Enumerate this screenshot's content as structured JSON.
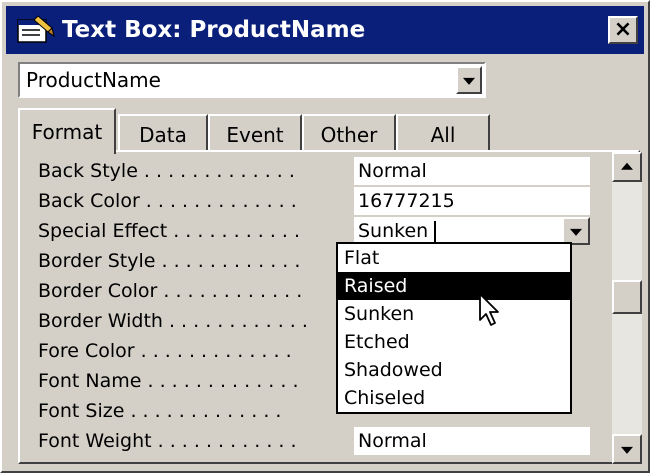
{
  "window": {
    "title": "Text Box: ProductName",
    "close_glyph": "×",
    "accent_title_bar": "#0a1f7a"
  },
  "object_selector": {
    "value": "ProductName"
  },
  "tabs": [
    {
      "label": "Format",
      "active": true
    },
    {
      "label": "Data",
      "active": false
    },
    {
      "label": "Event",
      "active": false
    },
    {
      "label": "Other",
      "active": false
    },
    {
      "label": "All",
      "active": false
    }
  ],
  "properties": [
    {
      "label": "Back Style . . . . . . . . . . . . .",
      "value": "Normal"
    },
    {
      "label": "Back Color . . . . . . . . . . . . .",
      "value": "16777215"
    },
    {
      "label": "Special Effect . . . . . . . . . . .",
      "value": "Sunken"
    },
    {
      "label": "Border Style . . . . . . . . . . . .",
      "value": ""
    },
    {
      "label": "Border Color . . . . . . . . . . . .",
      "value": ""
    },
    {
      "label": "Border Width . . . . . . . . . . . .",
      "value": ""
    },
    {
      "label": "Fore Color . . . . . . . . . . . . .",
      "value": ""
    },
    {
      "label": "Font Name . . . . . . . . . . . . .",
      "value": ""
    },
    {
      "label": "Font Size . . . . . . . . . . . . .",
      "value": ""
    },
    {
      "label": "Font Weight . . . . . . . . . . . .",
      "value": "Normal"
    }
  ],
  "dropdown": {
    "options": [
      "Flat",
      "Raised",
      "Sunken",
      "Etched",
      "Shadowed",
      "Chiseled"
    ],
    "highlighted": "Raised"
  },
  "scrollbar": {
    "position": 0.45
  }
}
